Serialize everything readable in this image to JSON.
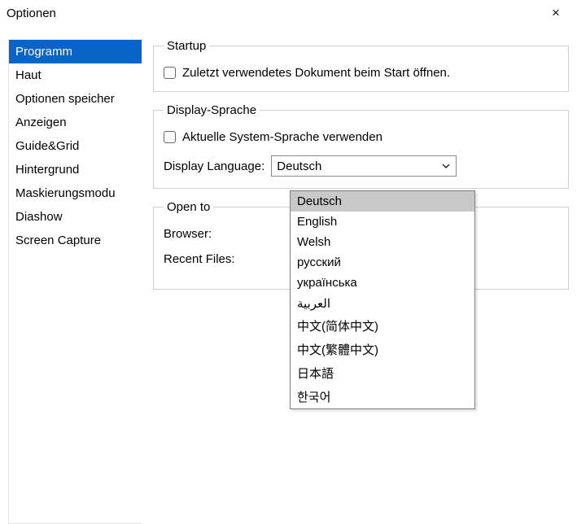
{
  "window": {
    "title": "Optionen"
  },
  "sidebar": {
    "items": [
      {
        "label": "Programm",
        "selected": true
      },
      {
        "label": "Haut",
        "selected": false
      },
      {
        "label": "Optionen speicher",
        "selected": false
      },
      {
        "label": "Anzeigen",
        "selected": false
      },
      {
        "label": "Guide&Grid",
        "selected": false
      },
      {
        "label": "Hintergrund",
        "selected": false
      },
      {
        "label": "Maskierungsmodu",
        "selected": false
      },
      {
        "label": "Diashow",
        "selected": false
      },
      {
        "label": "Screen Capture",
        "selected": false
      }
    ]
  },
  "startup": {
    "legend": "Startup",
    "open_last_label": "Zuletzt verwendetes Dokument beim Start öffnen.",
    "open_last_checked": false
  },
  "display_language": {
    "legend": "Display-Sprache",
    "use_system_label": "Aktuelle System-Sprache verwenden",
    "use_system_checked": false,
    "label": "Display Language:",
    "selected": "Deutsch",
    "options": [
      "Deutsch",
      "English",
      "Welsh",
      "русский",
      "українська",
      "العربية",
      "中文(简体中文)",
      "中文(繁體中文)",
      "日本語",
      "한국어"
    ],
    "highlighted_index": 0
  },
  "open_to": {
    "legend": "Open to",
    "browser_label": "Browser:",
    "recent_files_label": "Recent Files:"
  }
}
